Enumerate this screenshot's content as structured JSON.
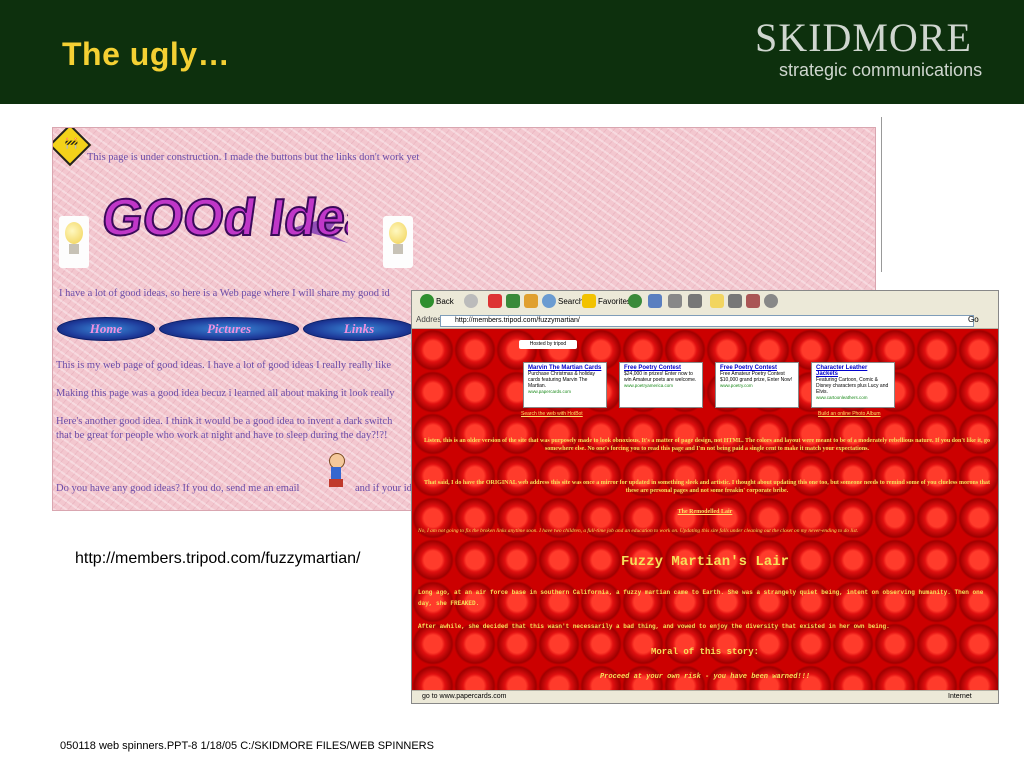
{
  "slide": {
    "title": "The ugly…",
    "brand_name": "SKIDMORE",
    "brand_tagline": "strategic communications",
    "caption_url": "http://members.tripod.com/fuzzymartian/",
    "footer": "050118 web spinners.PPT-8 1/18/05 C:/SKIDMORE FILES/WEB SPINNERS",
    "colors": {
      "header_bg": "#0d300d",
      "title": "#f4d033",
      "brand": "#cfd6cf"
    }
  },
  "shot1": {
    "construction_line": "This page is under construction. I made the buttons but the links don't work yet",
    "logo_text": "GOOd Ideas",
    "intro_line": "I have a lot of good ideas, so here is a Web page where I will share my good id",
    "buttons": [
      "Home",
      "Pictures",
      "Links"
    ],
    "line_web_page": "This is my web page of good ideas. I have a lot of good ideas I really really like",
    "line_making": "Making this page was a good idea becuz i learned all about making it look really",
    "line_another_1": "Here's another good idea. I think it would be a good idea to invent a dark switch",
    "line_another_2": "that be great for people who work at night and have to sleep during the day?!?!",
    "line_email": "Do you have any good ideas? If you do, send me an email",
    "line_email_tail": "and if your id",
    "icons": [
      "construction-sign-icon",
      "lightbulb-icon",
      "lightbulb-icon",
      "running-kid-icon"
    ]
  },
  "shot2": {
    "toolbar": {
      "back": "Back",
      "search": "Search",
      "favorites": "Favorites"
    },
    "address_label": "Address",
    "address_url": "http://members.tripod.com/fuzzymartian/",
    "go": "Go",
    "hosted_by": "Hosted by tripod",
    "ads": [
      {
        "title": "Marvin The Martian Cards",
        "body": "Purchase Christmas & holiday cards featuring Marvin The Martian.",
        "url": "www.papercards.com"
      },
      {
        "title": "Free Poetry Contest",
        "body": "$24,000 in prizes! Enter now to win Amateur poets are welcome.",
        "url": "www.poetryamerica.com"
      },
      {
        "title": "Free Poetry Contest",
        "body": "Free Amateur Poetry Contest $10,000 grand prize, Enter Now!",
        "url": "www.poetry.com"
      },
      {
        "title": "Character Leather Jackets",
        "body": "Featuring Cartoon, Comic & Disney characters plus Lucy and Elvis.",
        "url": "www.cartoonleathers.com"
      }
    ],
    "search_link": "Search the web with HotBot",
    "album_link": "Build an online Photo Album",
    "para1": "Listen, this is an older version of the site that was purposely made to look obnoxious. It's a matter of page design, not HTML. The colors and layout were meant to be of a moderately rebellious nature. If you don't like it, go somewhere else. No one's forcing you to read this page and I'm not being paid a single cent to make it match your expectations.",
    "para2": "That said, I do have the ORIGINAL web address this site was once a mirror for updated in something sleek and artistic. I thought about updating this one too, but someone needs to remind some of you clueless morons that these are personal pages and not some freakin' corporate bribe.",
    "remodelled_link": "The Remodelled Lair",
    "para3": "No, I am not going to fix the broken links anytime soon. I have two children, a full-time job and an education to work on. Updating this site falls under cleaning out the closet on my never-ending to do list.",
    "lair_title": "Fuzzy Martian's Lair",
    "story1": "Long ago, at an air force base in southern California, a fuzzy martian came to Earth. She was a strangely quiet being, intent on observing humanity. Then one day, she FREAKED.",
    "story2": "After awhile, she decided that this wasn't necessarily a bad thing, and vowed to enjoy the diversity that existed in her own being.",
    "moral_heading": "Moral of this story:",
    "moral_text": "Proceed at your own risk - you have been warned!!!",
    "status_left": "go to www.papercards.com",
    "status_right": "Internet"
  }
}
